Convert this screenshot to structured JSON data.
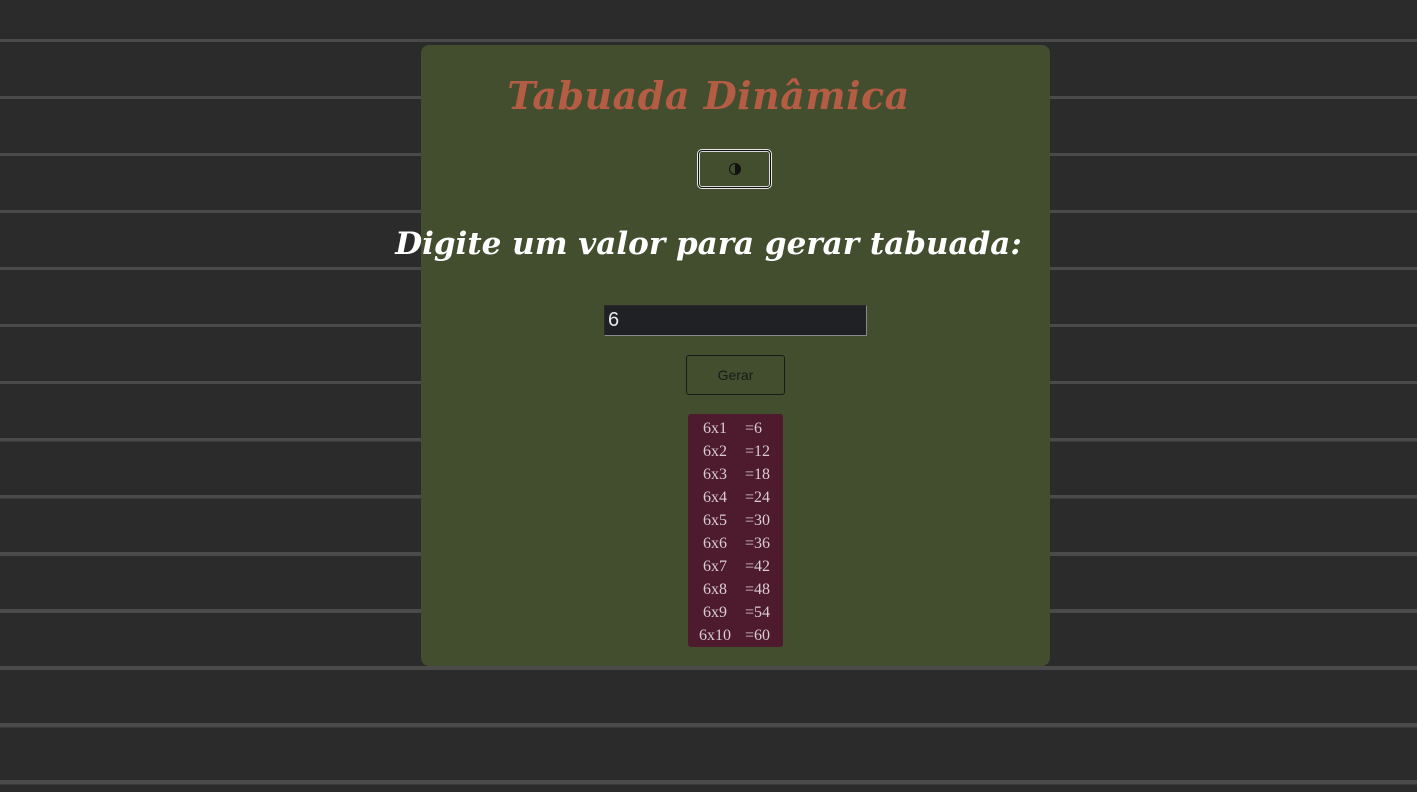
{
  "app": {
    "title": "Tabuada Dinâmica",
    "prompt": "Digite um valor para gerar tabuada:",
    "theme_toggle_icon": "half-circle-contrast-icon",
    "input": {
      "value": "6",
      "placeholder": ""
    },
    "generate_label": "Gerar"
  },
  "table": {
    "rows": [
      {
        "expr": "6x1",
        "result": "=6"
      },
      {
        "expr": "6x2",
        "result": "=12"
      },
      {
        "expr": "6x3",
        "result": "=18"
      },
      {
        "expr": "6x4",
        "result": "=24"
      },
      {
        "expr": "6x5",
        "result": "=30"
      },
      {
        "expr": "6x6",
        "result": "=36"
      },
      {
        "expr": "6x7",
        "result": "=42"
      },
      {
        "expr": "6x8",
        "result": "=48"
      },
      {
        "expr": "6x9",
        "result": "=54"
      },
      {
        "expr": "6x10",
        "result": "=60"
      }
    ]
  },
  "colors": {
    "page_bg": "#2b2b2b",
    "card_bg": "#434e2f",
    "title": "#b55c45",
    "results_bg": "#4d1a2e"
  }
}
